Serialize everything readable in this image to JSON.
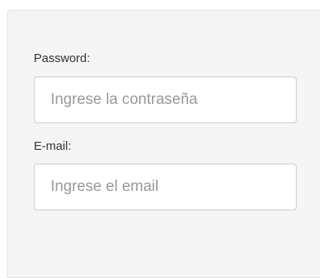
{
  "form": {
    "password": {
      "label": "Password:",
      "placeholder": "Ingrese la contraseña",
      "value": ""
    },
    "email": {
      "label": "E-mail:",
      "placeholder": "Ingrese el email",
      "value": ""
    }
  }
}
